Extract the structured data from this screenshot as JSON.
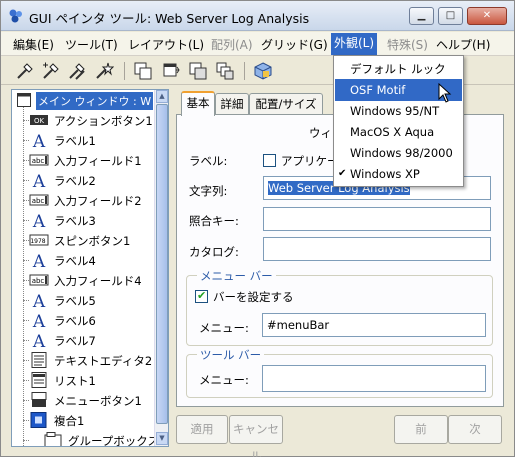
{
  "window": {
    "title": "GUI ペインタ ツール: Web Server Log Analysis",
    "controls": [
      "minimize",
      "maximize",
      "close"
    ]
  },
  "menubar": {
    "items": [
      {
        "label": "編集(E)",
        "enabled": true
      },
      {
        "label": "ツール(T)",
        "enabled": true
      },
      {
        "label": "レイアウト(L)",
        "enabled": true
      },
      {
        "label": "配列(A)",
        "enabled": false
      },
      {
        "label": "グリッド(G)",
        "enabled": true
      },
      {
        "label": "外観(L)",
        "enabled": true,
        "active": true
      },
      {
        "label": "特殊(S)",
        "enabled": false
      },
      {
        "label": "ヘルプ(H)",
        "enabled": true
      }
    ]
  },
  "toolbar": {
    "icons": [
      "wand-icon",
      "wand-add-icon",
      "wand-multi-icon",
      "wand-star-icon",
      "copy-window-icon",
      "window-icon",
      "window-group-icon",
      "window-layers-icon",
      "cube-icon"
    ]
  },
  "appearance_menu": {
    "items": [
      {
        "label": "デフォルト ルック",
        "checked": false,
        "hover": false
      },
      {
        "label": "OSF Motif",
        "checked": false,
        "hover": true
      },
      {
        "label": "Windows 95/NT",
        "checked": false,
        "hover": false
      },
      {
        "label": "MacOS X Aqua",
        "checked": false,
        "hover": false
      },
      {
        "label": "Windows 98/2000",
        "checked": false,
        "hover": false
      },
      {
        "label": "Windows XP",
        "checked": true,
        "hover": false
      }
    ],
    "check_mark": "✔"
  },
  "tree": {
    "root": "メイン ウィンドウ : W",
    "items": [
      {
        "label": "アクションボタン1",
        "icon": "ok-button-icon",
        "icon_text": "OK"
      },
      {
        "label": "ラベル1",
        "icon": "label-a-icon",
        "icon_text": "A"
      },
      {
        "label": "入力フィールド1",
        "icon": "text-field-icon",
        "icon_text": "abc"
      },
      {
        "label": "ラベル2",
        "icon": "label-a-icon",
        "icon_text": "A"
      },
      {
        "label": "入力フィールド2",
        "icon": "text-field-icon",
        "icon_text": "abc"
      },
      {
        "label": "ラベル3",
        "icon": "label-a-icon",
        "icon_text": "A"
      },
      {
        "label": "スピンボタン1",
        "icon": "spin-button-icon",
        "icon_text": "1978"
      },
      {
        "label": "ラベル4",
        "icon": "label-a-icon",
        "icon_text": "A"
      },
      {
        "label": "入力フィールド4",
        "icon": "text-field-icon",
        "icon_text": "abc"
      },
      {
        "label": "ラベル5",
        "icon": "label-a-icon",
        "icon_text": "A"
      },
      {
        "label": "ラベル6",
        "icon": "label-a-icon",
        "icon_text": "A"
      },
      {
        "label": "ラベル7",
        "icon": "label-a-icon",
        "icon_text": "A"
      },
      {
        "label": "テキストエディタ2",
        "icon": "text-editor-icon",
        "icon_text": ""
      },
      {
        "label": "リスト1",
        "icon": "list-icon",
        "icon_text": ""
      },
      {
        "label": "メニューボタン1",
        "icon": "menu-button-icon",
        "icon_text": ""
      },
      {
        "label": "複合1",
        "icon": "composite-icon",
        "icon_text": ""
      },
      {
        "label": "グループボックス",
        "icon": "group-box-icon",
        "icon_text": ""
      }
    ]
  },
  "tabs": [
    {
      "label": "基本",
      "selected": true
    },
    {
      "label": "詳細",
      "selected": false
    },
    {
      "label": "配置/サイズ",
      "selected": false
    }
  ],
  "form": {
    "panel_heading": "ウィ",
    "label_label": "ラベル:",
    "app_checkbox_label": "アプリケー",
    "string_label": "文字列:",
    "string_value": "Web Server Log Analysis",
    "ref_key_label": "照合キー:",
    "ref_key_value": "",
    "catalog_label": "カタログ:",
    "catalog_value": "",
    "menubar_group": {
      "title": "メニュー バー",
      "set_checkbox_label": "バーを設定する",
      "set_checked": true,
      "menu_label": "メニュー:",
      "menu_value": "#menuBar"
    },
    "toolbar_group": {
      "title": "ツール バー",
      "menu_label": "メニュー:",
      "menu_value": ""
    }
  },
  "buttons": {
    "apply": "適用",
    "cancel": "キャンセル",
    "prev": "前",
    "next": "次"
  }
}
